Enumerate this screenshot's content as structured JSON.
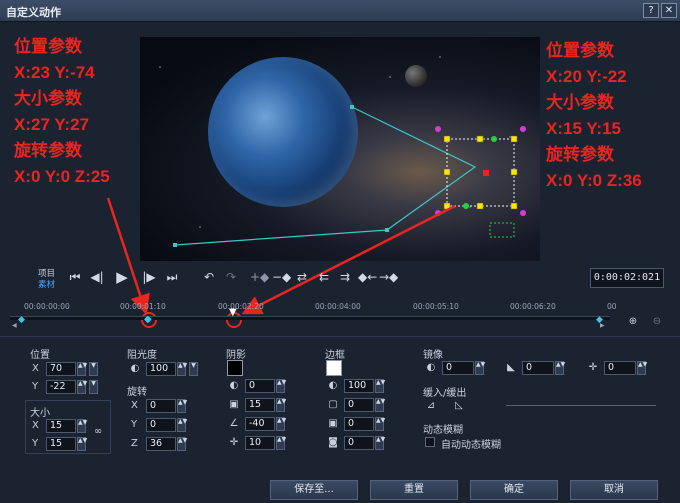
{
  "window": {
    "title": "自定义动作",
    "help": "?",
    "close": "✕"
  },
  "annotations": {
    "left": [
      "位置参数",
      "X:23  Y:-74",
      "大小参数",
      "X:27  Y:27",
      "旋转参数",
      "X:0  Y:0  Z:25"
    ],
    "right": [
      "位置参数",
      "X:20  Y:-22",
      "大小参数",
      "X:15  Y:15",
      "旋转参数",
      "X:0  Y:0  Z:36"
    ]
  },
  "playback": {
    "project_label": "项目",
    "clip_label": "素材",
    "timecode": "0:00:02:021"
  },
  "timeline": {
    "ticks": [
      "00:00:00:00",
      "00:00:01:10",
      "00:00:02:20",
      "00:00:04:00",
      "00:00:05:10",
      "00:00:06:20",
      "00"
    ]
  },
  "position": {
    "title": "位置",
    "x_label": "X",
    "x": "70",
    "y_label": "Y",
    "y": "-22"
  },
  "size": {
    "title": "大小",
    "x_label": "X",
    "x": "15",
    "y_label": "Y",
    "y": "15"
  },
  "opacity": {
    "title": "阻光度",
    "value": "100"
  },
  "rotation": {
    "title": "旋转",
    "x_label": "X",
    "x": "0",
    "y_label": "Y",
    "y": "0",
    "z_label": "Z",
    "z": "36"
  },
  "shadow": {
    "title": "阴影",
    "color": "#000000",
    "v1": "0",
    "v2": "15",
    "v3": "-40",
    "v4": "10"
  },
  "border": {
    "title": "边框",
    "color": "#ffffff",
    "v1": "100",
    "v2": "0",
    "v3": "0",
    "v4": "0"
  },
  "mirror": {
    "title": "镜像",
    "v1": "0",
    "v2": "0",
    "v3": "0"
  },
  "ease": {
    "title": "缓入/缓出"
  },
  "motion_blur": {
    "title": "动态模糊",
    "checkbox_label": "自动动态模糊"
  },
  "buttons": {
    "save_as": "保存至...",
    "reset": "重置",
    "ok": "确定",
    "cancel": "取消"
  }
}
